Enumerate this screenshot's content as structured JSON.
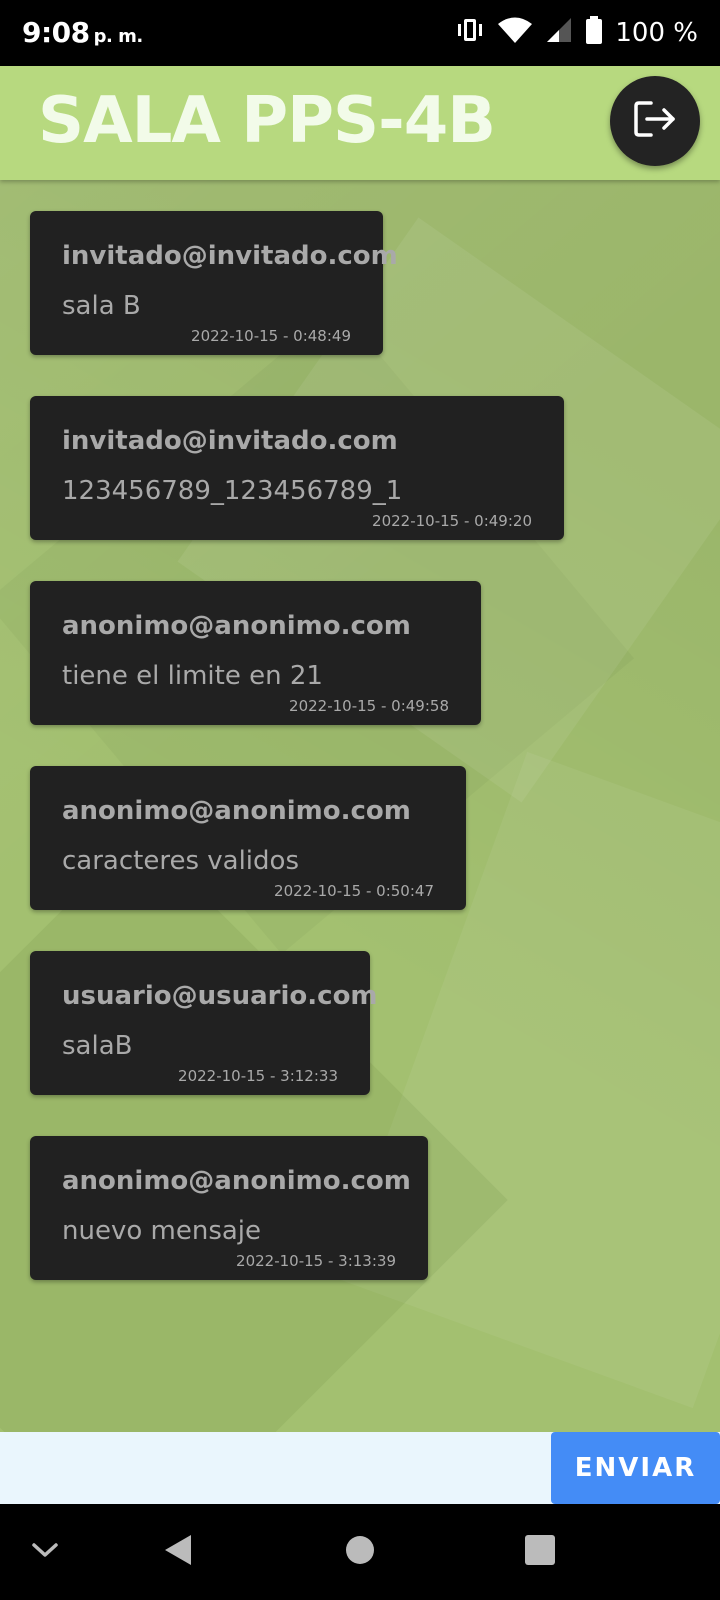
{
  "status_bar": {
    "time": "9:08",
    "time_suffix": "p. m.",
    "battery": "100 %",
    "icons": [
      "vibrate-icon",
      "wifi-icon",
      "signal-icon",
      "battery-icon"
    ]
  },
  "header": {
    "title": "SALA PPS-4B",
    "logout_icon": "logout-icon",
    "background": "#b7d97f"
  },
  "messages": [
    {
      "sender": "invitado@invitado.com",
      "text": "sala B",
      "timestamp": "2022-10-15 - 0:48:49"
    },
    {
      "sender": "invitado@invitado.com",
      "text": "123456789_123456789_1",
      "timestamp": "2022-10-15 - 0:49:20"
    },
    {
      "sender": "anonimo@anonimo.com",
      "text": "tiene el limite en 21",
      "timestamp": "2022-10-15 - 0:49:58"
    },
    {
      "sender": "anonimo@anonimo.com",
      "text": "caracteres validos",
      "timestamp": "2022-10-15 - 0:50:47"
    },
    {
      "sender": "usuario@usuario.com",
      "text": "salaB",
      "timestamp": "2022-10-15 - 3:12:33"
    },
    {
      "sender": "anonimo@anonimo.com",
      "text": "nuevo mensaje",
      "timestamp": "2022-10-15 - 3:13:39"
    }
  ],
  "composer": {
    "value": "",
    "send_label": "ENVIAR",
    "send_color": "#448cf6"
  },
  "nav_bar": {
    "icons": [
      "chevron-down-icon",
      "back-icon",
      "home-icon",
      "recents-icon"
    ]
  }
}
